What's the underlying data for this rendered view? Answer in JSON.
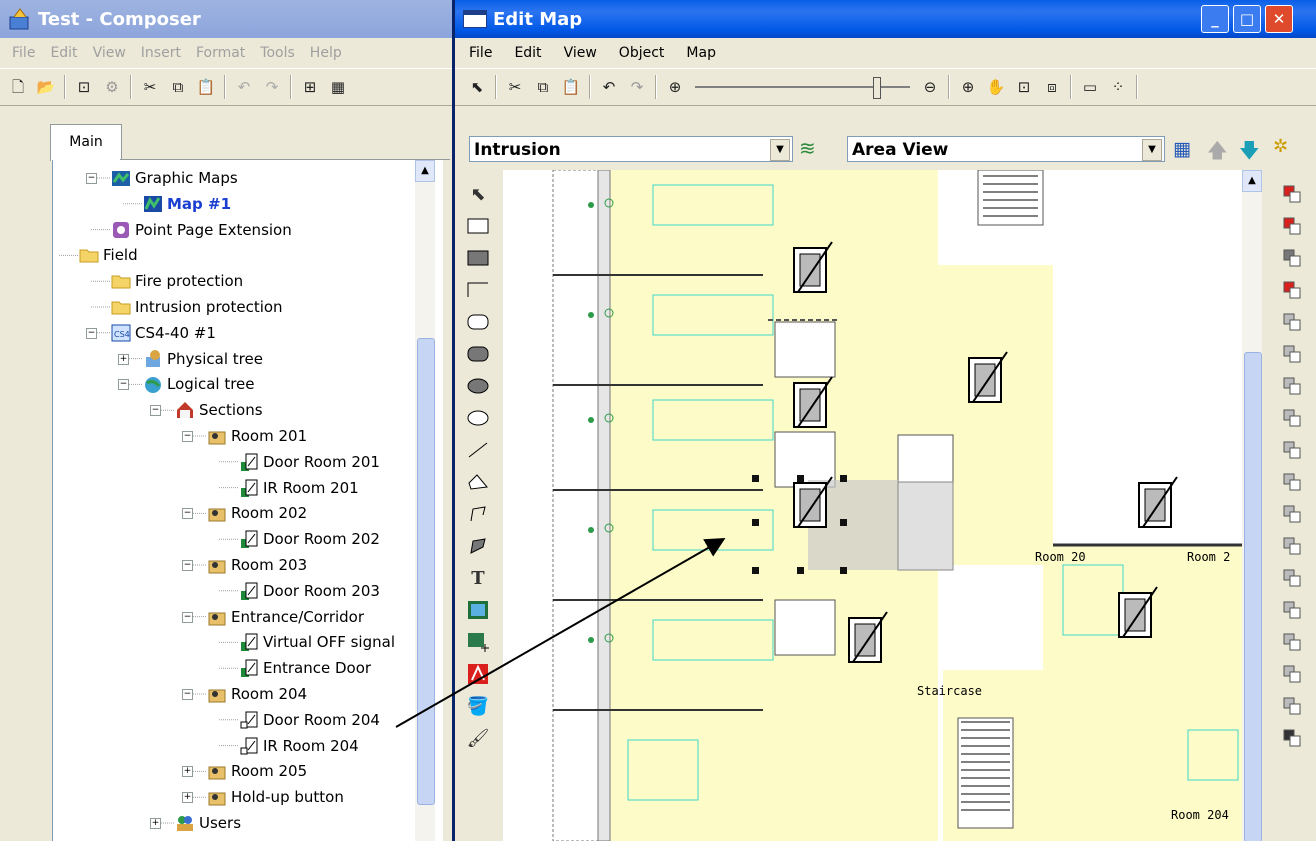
{
  "composer": {
    "title": "Test - Composer",
    "menu": [
      "File",
      "Edit",
      "View",
      "Insert",
      "Format",
      "Tools",
      "Help"
    ],
    "tab": "Main",
    "tree": [
      {
        "label": "Graphic Maps",
        "icon": "map-folder-icon",
        "indent": 1,
        "expander": "-"
      },
      {
        "label": "Map #1",
        "icon": "map-icon",
        "indent": 2,
        "selected": true
      },
      {
        "label": "Point Page Extension",
        "icon": "extension-icon",
        "indent": 1
      },
      {
        "label": "Field",
        "icon": "folder-icon",
        "indent": 0
      },
      {
        "label": "Fire protection",
        "icon": "folder-icon",
        "indent": 1
      },
      {
        "label": "Intrusion protection",
        "icon": "folder-icon",
        "indent": 1
      },
      {
        "label": "CS4-40 #1",
        "icon": "controller-icon",
        "indent": 1,
        "expander": "-"
      },
      {
        "label": "Physical tree",
        "icon": "physical-tree-icon",
        "indent": 2,
        "expander": "+"
      },
      {
        "label": "Logical tree",
        "icon": "logical-tree-icon",
        "indent": 2,
        "expander": "-"
      },
      {
        "label": "Sections",
        "icon": "house-icon",
        "indent": 3,
        "expander": "-"
      },
      {
        "label": "Room 201",
        "icon": "section-icon",
        "indent": 4,
        "expander": "-"
      },
      {
        "label": "Door Room 201",
        "icon": "door-point-icon",
        "indent": 5
      },
      {
        "label": "IR Room 201",
        "icon": "door-point-icon",
        "indent": 5
      },
      {
        "label": "Room 202",
        "icon": "section-icon",
        "indent": 4,
        "expander": "-"
      },
      {
        "label": "Door Room 202",
        "icon": "door-point-icon",
        "indent": 5
      },
      {
        "label": "Room 203",
        "icon": "section-icon",
        "indent": 4,
        "expander": "-"
      },
      {
        "label": "Door Room 203",
        "icon": "door-point-icon",
        "indent": 5
      },
      {
        "label": "Entrance/Corridor",
        "icon": "section-icon",
        "indent": 4,
        "expander": "-"
      },
      {
        "label": "Virtual OFF signal",
        "icon": "door-point-icon",
        "indent": 5
      },
      {
        "label": "Entrance Door",
        "icon": "door-point-icon",
        "indent": 5
      },
      {
        "label": "Room 204",
        "icon": "section-icon",
        "indent": 4,
        "expander": "-"
      },
      {
        "label": "Door Room 204",
        "icon": "door-point-plain-icon",
        "indent": 5
      },
      {
        "label": "IR Room 204",
        "icon": "door-point-plain-icon",
        "indent": 5
      },
      {
        "label": "Room 205",
        "icon": "section-icon",
        "indent": 4,
        "expander": "+"
      },
      {
        "label": "Hold-up button",
        "icon": "section-icon",
        "indent": 4,
        "expander": "+"
      },
      {
        "label": "Users",
        "icon": "users-icon",
        "indent": 3,
        "expander": "+"
      }
    ]
  },
  "editmap": {
    "title": "Edit Map",
    "menu": [
      "File",
      "Edit",
      "View",
      "Object",
      "Map"
    ],
    "layer_combo": "Intrusion",
    "view_combo": "Area View",
    "map_labels": {
      "room_a": "Room 20",
      "room_b": "Room 2",
      "staircase": "Staircase",
      "room_c": "Room 204"
    }
  },
  "colors": {
    "xp_title": "#0058e6",
    "map_fill": "#fdfcc8",
    "furniture": "#3fd6c8"
  }
}
